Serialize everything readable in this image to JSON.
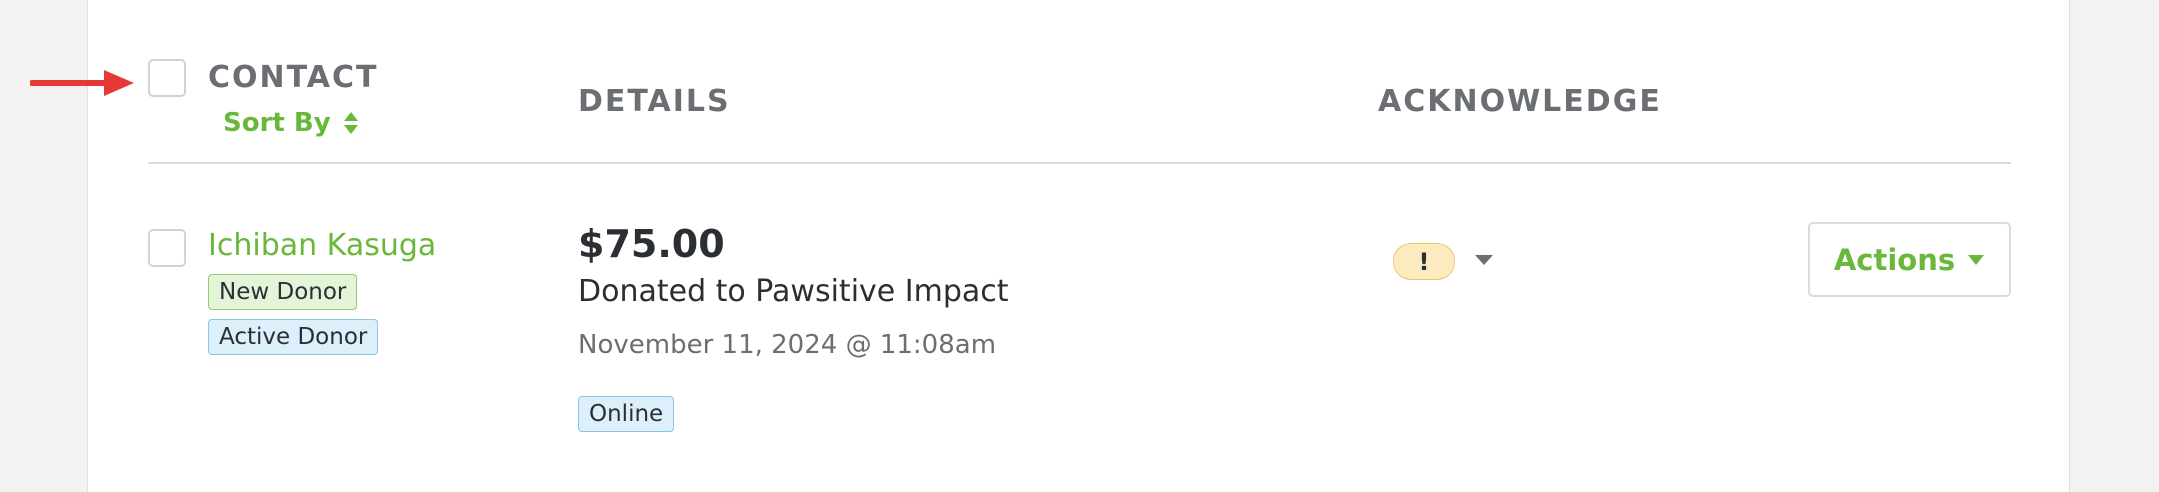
{
  "header": {
    "contact_label": "CONTACT",
    "sort_by_label": "Sort By",
    "details_label": "DETAILS",
    "acknowledge_label": "ACKNOWLEDGE"
  },
  "rows": [
    {
      "contact_name": "Ichiban Kasuga",
      "tags": [
        "New Donor",
        "Active Donor"
      ],
      "amount": "$75.00",
      "description": "Donated to Pawsitive Impact",
      "date": "November 11, 2024 @ 11:08am",
      "channel": "Online",
      "acknowledge_status": "!",
      "actions_label": "Actions"
    }
  ],
  "colors": {
    "accent_green": "#6ab83b",
    "warning_badge": "#fdebc0",
    "arrow_red": "#e53935"
  },
  "icons": {
    "pointer": "red-arrow-icon",
    "sort": "sort-icon",
    "dropdown": "caret-down-icon"
  }
}
